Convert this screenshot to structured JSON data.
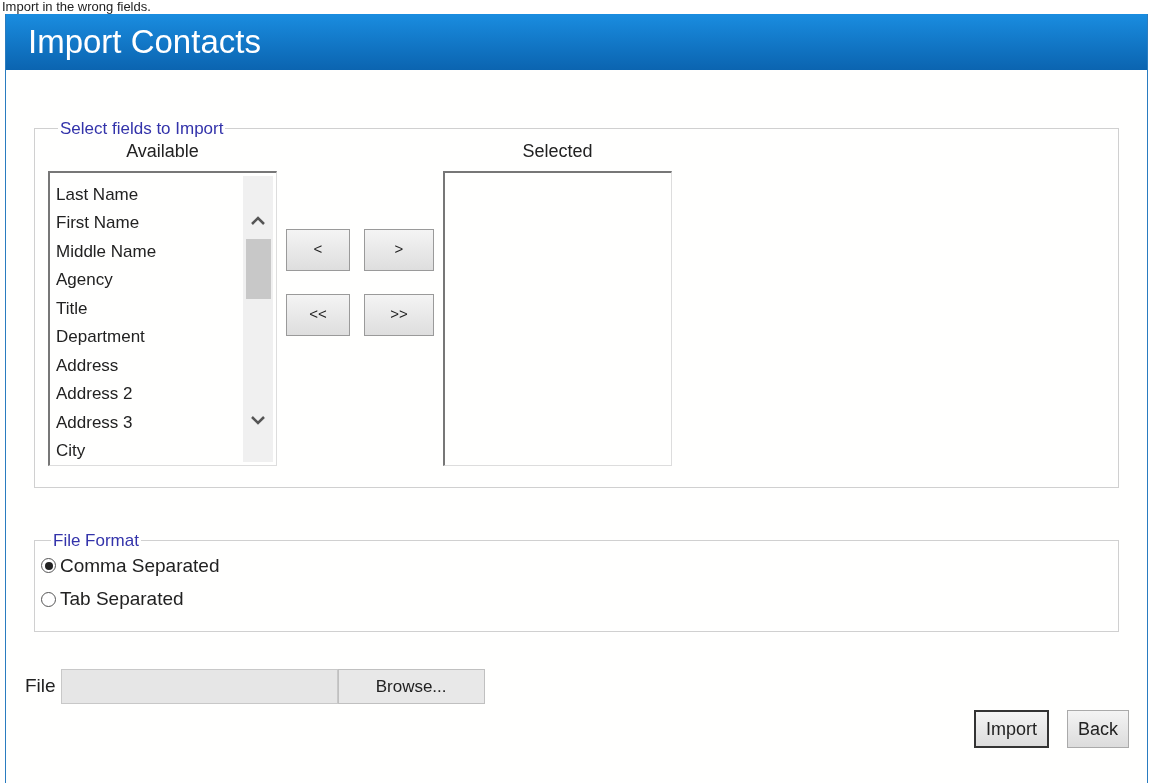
{
  "caption": "Import in the wrong fields.",
  "window": {
    "title": "Import Contacts"
  },
  "fields_group": {
    "legend": "Select fields to Import",
    "available": {
      "heading": "Available",
      "items": [
        "Last Name",
        "First Name",
        "Middle Name",
        "Agency",
        "Title",
        "Department",
        "Address",
        "Address 2",
        "Address 3",
        "City"
      ]
    },
    "move_buttons": [
      "<",
      ">",
      "<<",
      ">>"
    ],
    "selected": {
      "heading": "Selected"
    }
  },
  "file_format": {
    "legend": "File Format",
    "options": [
      {
        "label": "Comma Separated",
        "selected": true
      },
      {
        "label": "Tab Separated",
        "selected": false
      }
    ]
  },
  "file": {
    "label": "File",
    "browse": "Browse..."
  },
  "buttons": [
    "Import",
    "Back"
  ]
}
